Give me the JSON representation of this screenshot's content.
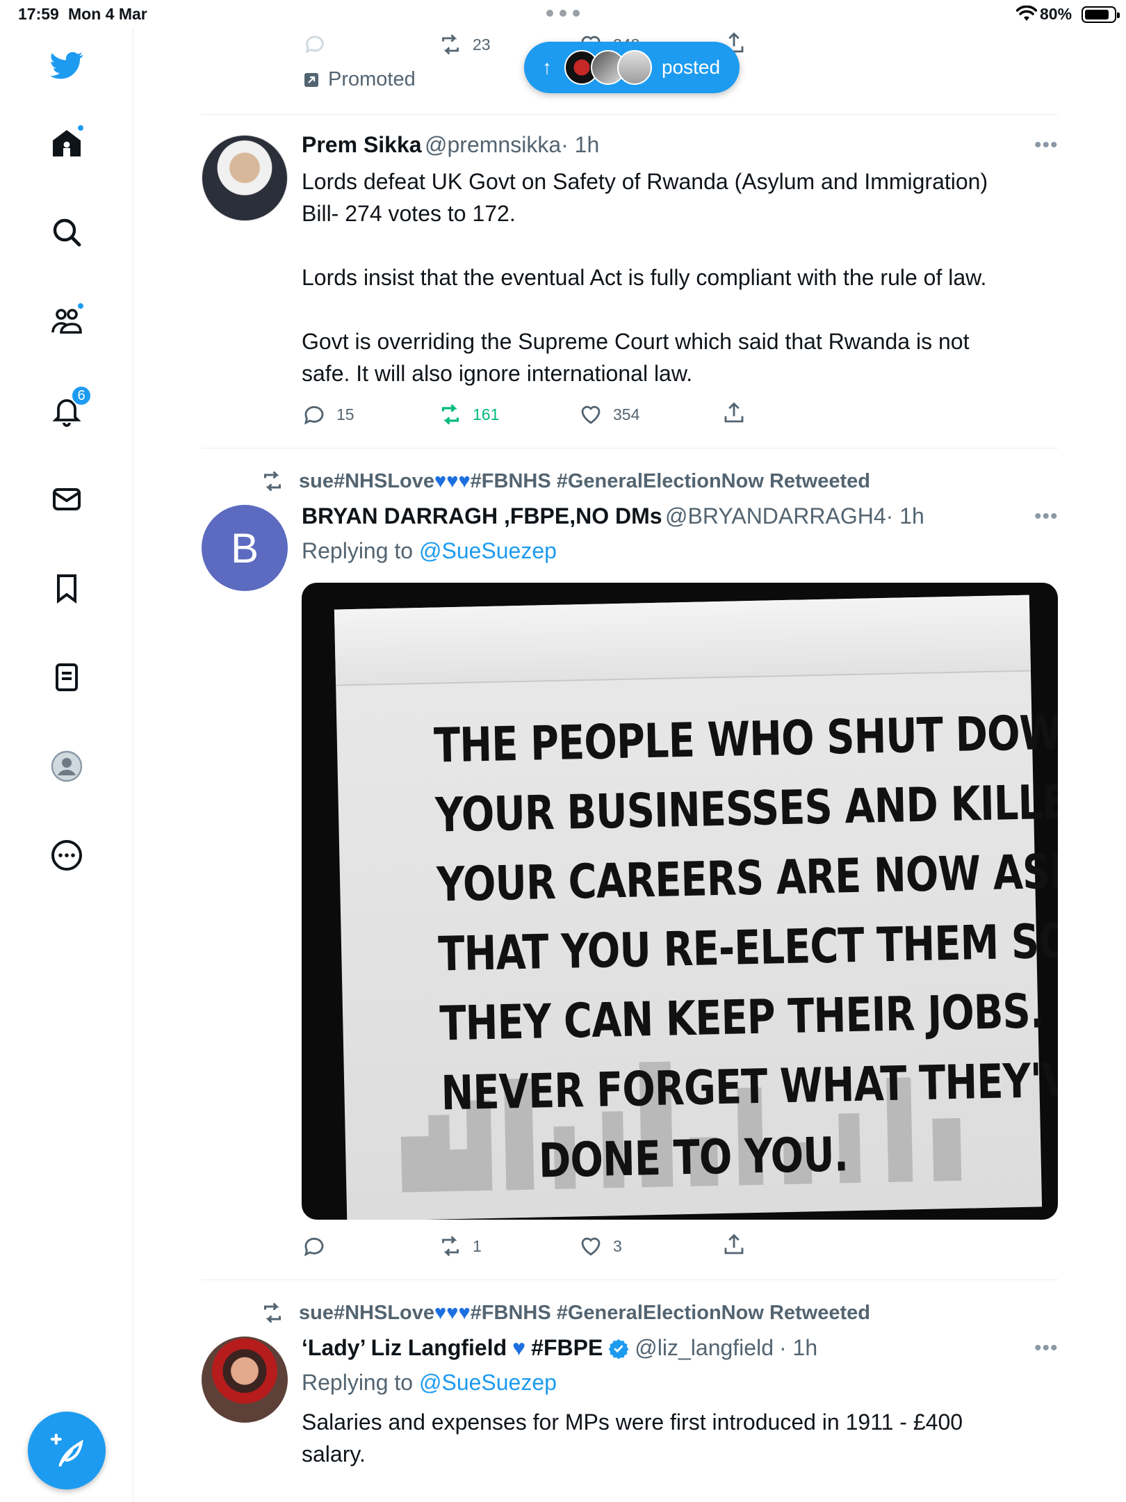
{
  "status_bar": {
    "time": "17:59",
    "date": "Mon 4 Mar",
    "battery": "80%"
  },
  "sidebar": {
    "notifications_badge": "6"
  },
  "pill": {
    "label": "posted"
  },
  "promoted_tweet": {
    "retweets": "23",
    "likes": "248",
    "promoted_label": "Promoted"
  },
  "tweet1": {
    "name": "Prem Sikka",
    "handle": "@premnsikka",
    "time": "· 1h",
    "text_lines": [
      "Lords defeat UK Govt on Safety of Rwanda (Asylum and Immigration)",
      "Bill- 274 votes to 172.",
      "Lords insist that the eventual Act is fully compliant with the rule of law.",
      "Govt is overriding the Supreme Court which said that Rwanda is not",
      "safe. It will also ignore international law."
    ],
    "replies": "15",
    "retweets": "161",
    "likes": "354"
  },
  "tweet2": {
    "retweeted_by_name": "sue#NHSLove",
    "retweeted_by_tags": "#FBNHS #GeneralElectionNow Retweeted",
    "avatar_letter": "B",
    "name": "BRYAN DARRAGH ,FBPE,NO DMs",
    "handle": "@BRYANDARRAGH4",
    "time": "· 1h",
    "replying_prefix": "Replying to",
    "replying_to": "@SueSuezep",
    "image_text_lines": [
      "THE PEOPLE WHO SHUT DOWN",
      "YOUR BUSINESSES AND KILLED",
      "YOUR CAREERS ARE NOW ASKING",
      "THAT YOU RE-ELECT THEM SO",
      "THEY CAN KEEP THEIR JOBS.",
      "NEVER FORGET WHAT THEY'VE",
      "DONE TO YOU."
    ],
    "retweets": "1",
    "likes": "3"
  },
  "tweet3": {
    "retweeted_by_name": "sue#NHSLove",
    "retweeted_by_tags": "#FBNHS #GeneralElectionNow Retweeted",
    "name_part1": "‘Lady’ Liz Langfield",
    "name_part2": "#FBPE",
    "handle": "@liz_langfield",
    "time": "· 1h",
    "replying_prefix": "Replying to",
    "replying_to": "@SueSuezep",
    "text_lines": [
      "Salaries and expenses for MPs were first introduced in 1911 - £400",
      "salary."
    ]
  },
  "colors": {
    "accent": "#1d9bf0",
    "retweet_green": "#00ba7c",
    "muted": "#536471"
  }
}
